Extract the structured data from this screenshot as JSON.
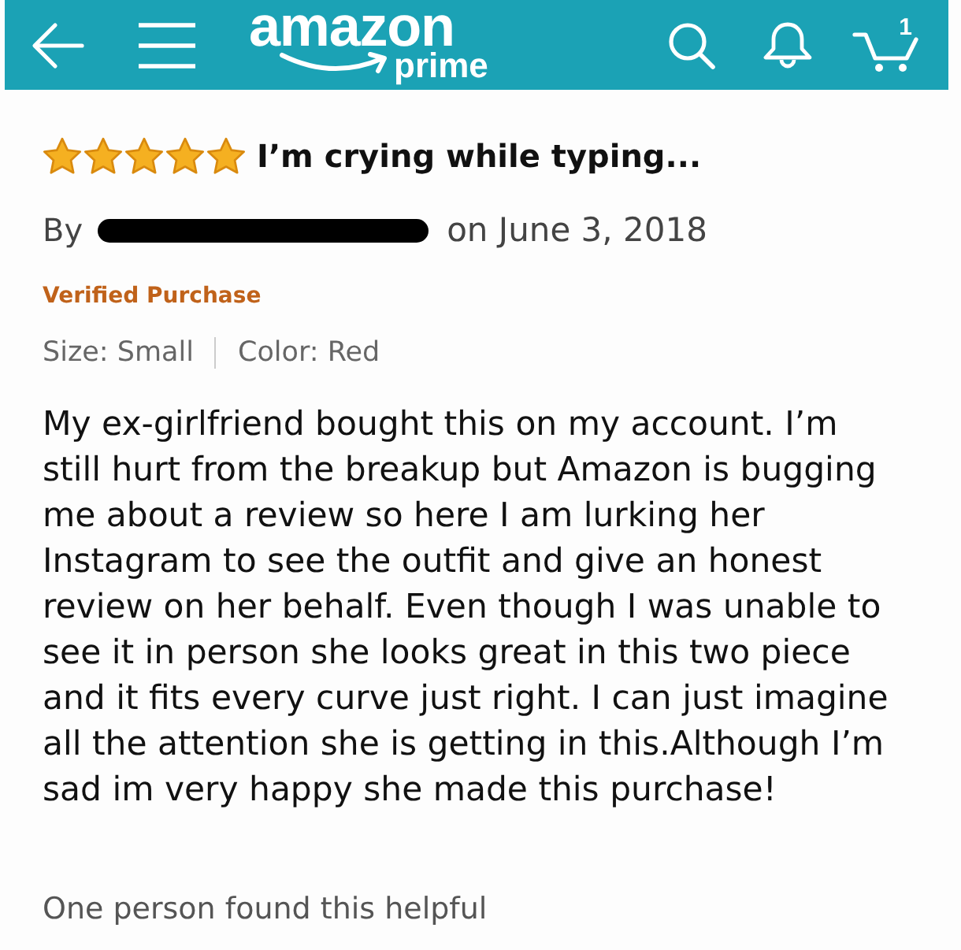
{
  "header": {
    "logo": "amazon",
    "logo_sub": "prime",
    "cart_count": "1"
  },
  "review": {
    "stars": 5,
    "title": "I’m crying while typing...",
    "by": "By",
    "date": "on June 3, 2018",
    "badge": "Verified Purchase",
    "variants": [
      "Size: Small",
      "Color: Red"
    ],
    "body": "My ex-girlfriend bought this on my account. I’m\nstill hurt from the breakup but Amazon is bugging\nme about a review so here I am lurking her\nInstagram to see the outfit and give an honest\nreview on her behalf. Even though I was unable to\nsee it in person she looks great in this two piece\nand it fits every curve just right. I can just imagine\nall the attention she is getting in this.Although I’m\nsad im very happy she made this purchase!",
    "helpful": "One person found this helpful"
  }
}
